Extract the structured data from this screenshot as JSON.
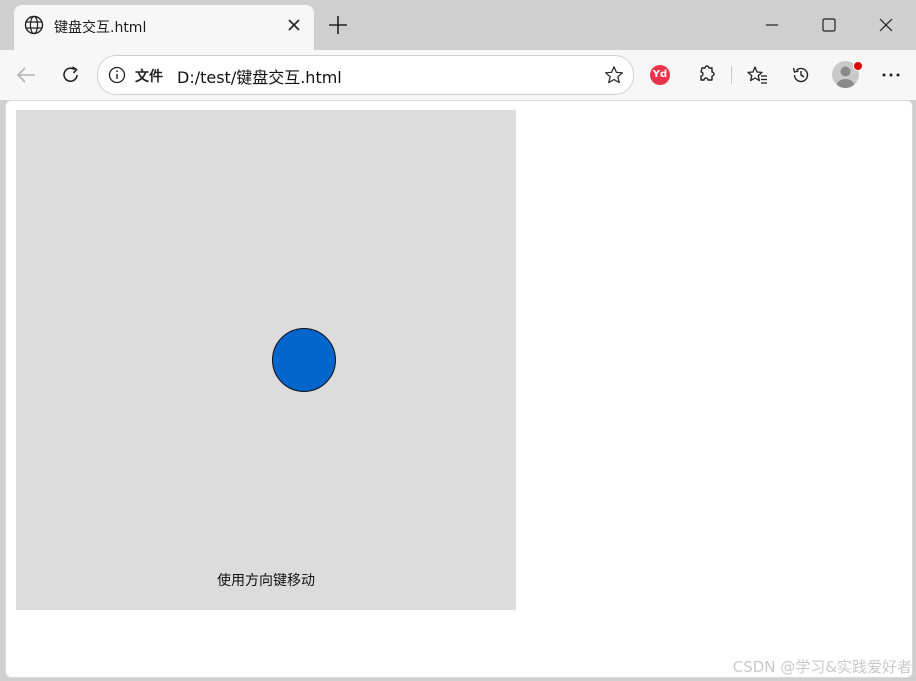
{
  "browser": {
    "tab": {
      "title": "键盘交互.html",
      "icon": "globe-icon"
    },
    "address_bar": {
      "label": "文件",
      "url": "D:/test/键盘交互.html"
    },
    "extensions": {
      "yd_label": "Yd"
    }
  },
  "page": {
    "hint": "使用方向键移动",
    "colors": {
      "area": "#dcdcdc",
      "ball": "#0066cc"
    }
  },
  "watermark": "CSDN @学习&实践爱好者"
}
